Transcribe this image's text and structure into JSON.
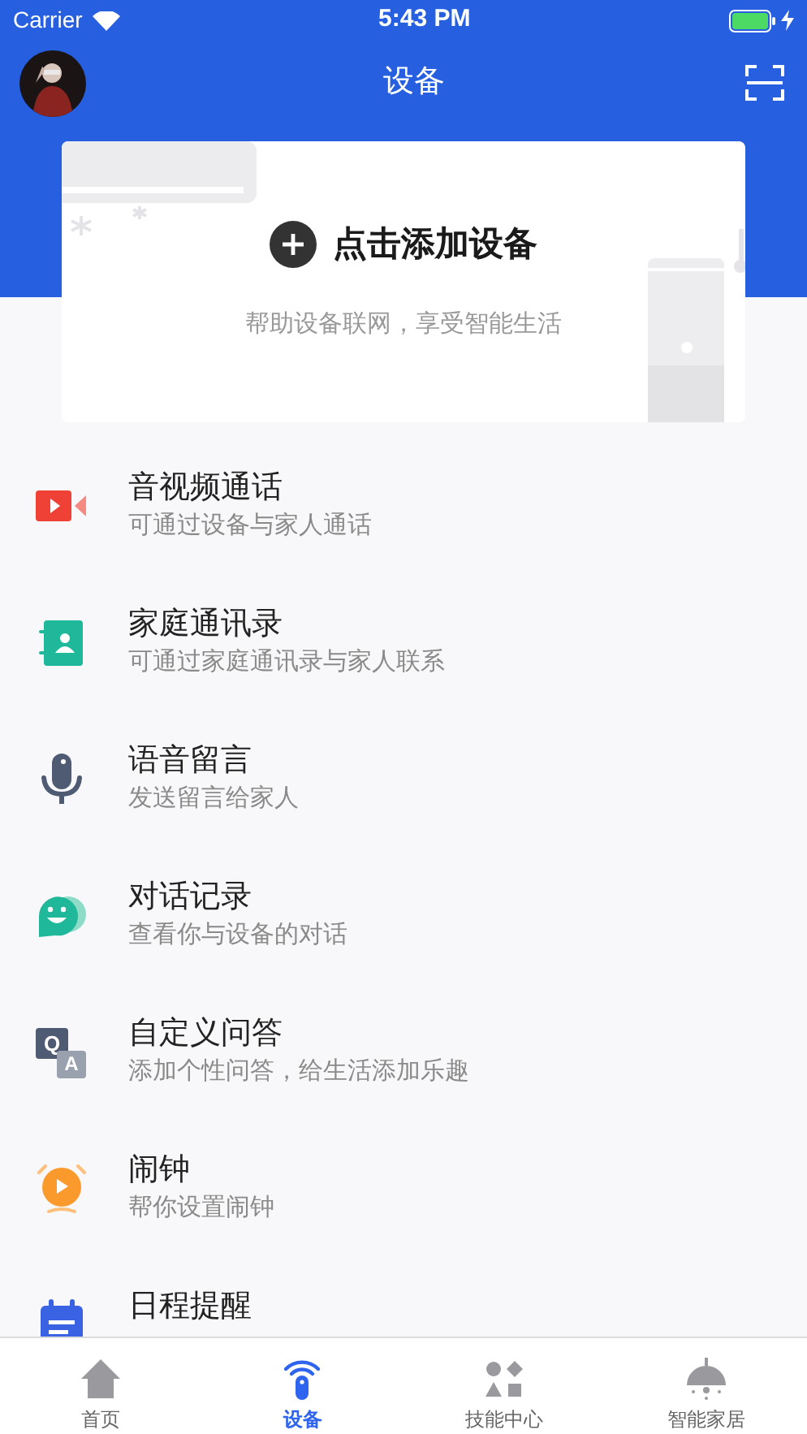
{
  "status_bar": {
    "carrier": "Carrier",
    "time": "5:43 PM"
  },
  "nav": {
    "title": "设备"
  },
  "add_card": {
    "title": "点击添加设备",
    "subtitle": "帮助设备联网，享受智能生活"
  },
  "features": [
    {
      "kind": "video",
      "title": "音视频通话",
      "subtitle": "可通过设备与家人通话"
    },
    {
      "kind": "contacts",
      "title": "家庭通讯录",
      "subtitle": "可通过家庭通讯录与家人联系"
    },
    {
      "kind": "mic",
      "title": "语音留言",
      "subtitle": "发送留言给家人"
    },
    {
      "kind": "chat",
      "title": "对话记录",
      "subtitle": "查看你与设备的对话"
    },
    {
      "kind": "qa",
      "title": "自定义问答",
      "subtitle": "添加个性问答，给生活添加乐趣",
      "icon_letters": [
        "Q",
        "A"
      ]
    },
    {
      "kind": "alarm",
      "title": "闹钟",
      "subtitle": "帮你设置闹钟"
    },
    {
      "kind": "calendar",
      "title": "日程提醒"
    }
  ],
  "tab_bar": [
    {
      "kind": "home",
      "label": "首页",
      "selected": false
    },
    {
      "kind": "device",
      "label": "设备",
      "selected": true
    },
    {
      "kind": "skills",
      "label": "技能中心",
      "selected": false
    },
    {
      "kind": "smarthome",
      "label": "智能家居",
      "selected": false
    }
  ]
}
